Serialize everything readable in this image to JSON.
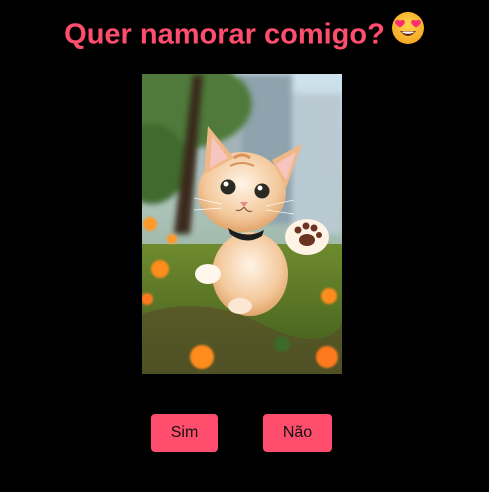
{
  "heading": {
    "text": "Quer namorar comigo?",
    "emoji_icon": "star-struck-face-icon"
  },
  "image": {
    "subject": "kitten-running-in-garden"
  },
  "buttons": {
    "yes_label": "Sim",
    "no_label": "Não"
  },
  "colors": {
    "background": "#000000",
    "accent": "#ff4d6d"
  }
}
